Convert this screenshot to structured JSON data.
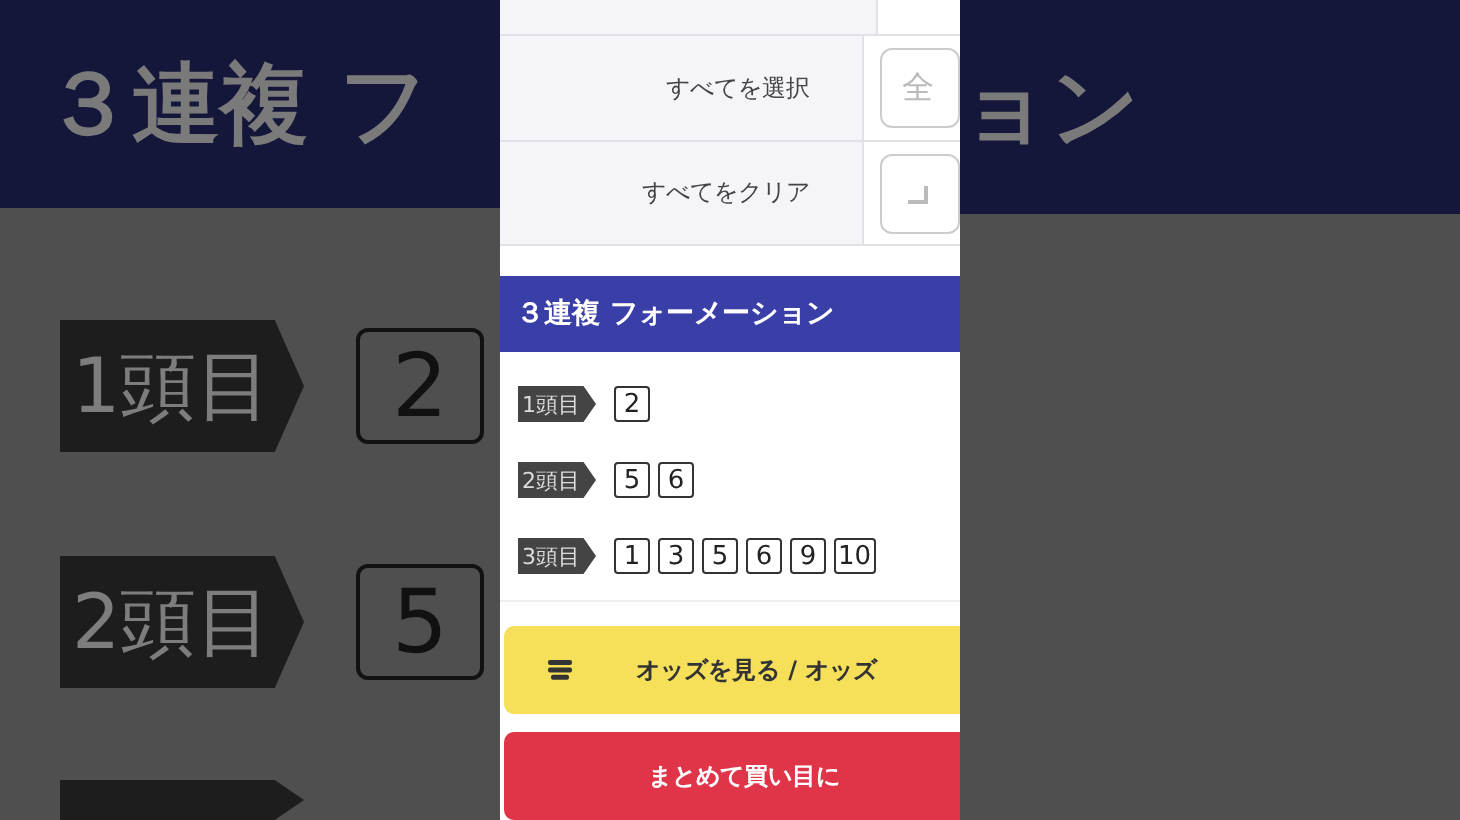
{
  "background": {
    "title_left": "３連複 フ",
    "title_right": "ョン",
    "legs": [
      {
        "label": "1頭目",
        "numbers": [
          "2"
        ]
      },
      {
        "label": "2頭目",
        "numbers": [
          "5"
        ]
      }
    ]
  },
  "actions": [
    {
      "kind": "text",
      "label": "すべてを選択",
      "button": "全"
    },
    {
      "kind": "icon",
      "label": "すべてをクリア"
    }
  ],
  "section": {
    "title": "３連複 フォーメーション",
    "legs": [
      {
        "label": "1頭目",
        "numbers": [
          "2"
        ]
      },
      {
        "label": "2頭目",
        "numbers": [
          "5",
          "6"
        ]
      },
      {
        "label": "3頭目",
        "numbers": [
          "1",
          "3",
          "5",
          "6",
          "9",
          "10"
        ]
      }
    ]
  },
  "buttons": [
    {
      "kind": "odds",
      "label": "オッズを見る / オッズ"
    },
    {
      "kind": "add",
      "label": "まとめて買い目に"
    }
  ]
}
